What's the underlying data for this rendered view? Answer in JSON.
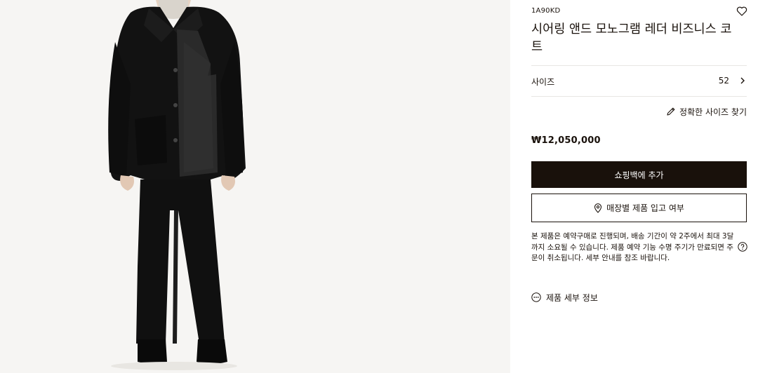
{
  "product": {
    "sku": "1A90KD",
    "title": "시어링 앤드 모노그램 레더 비즈니스 코트",
    "price": "₩12,050,000"
  },
  "size": {
    "label": "사이즈",
    "value": "52"
  },
  "fit_link_label": "정확한 사이즈 찾기",
  "buttons": {
    "add_to_bag": "쇼핑백에 추가",
    "store_availability": "매장별 제품 입고 여부"
  },
  "notice": "본 제품은 예약구매로 진행되며, 배송 기간이 약 2주에서 최대 3달까지 소요될 수 있습니다. 제품 예약 기능 수명 주기가 만료되면 주문이 취소됩니다. 세부 안내를 참조 바랍니다.",
  "details_link_label": "제품 세부 정보",
  "icons": {
    "wishlist": "heart-icon",
    "size_chevron": "chevron-right-icon",
    "fit": "ruler-pencil-icon",
    "store": "map-pin-icon",
    "help": "question-circle-icon",
    "details": "more-dots-circle-icon"
  },
  "colors": {
    "primary": "#19110b",
    "background_image": "#f6f5f3",
    "divider": "#e8e6e3"
  }
}
